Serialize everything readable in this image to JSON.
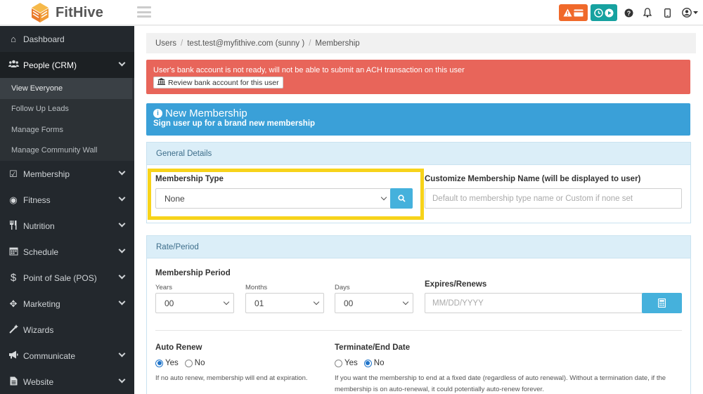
{
  "app": {
    "name": "FitHive"
  },
  "colors": {
    "alert_orange": "#f0692a",
    "teal": "#17a2a0",
    "danger": "#e8655a",
    "info": "#3aa0d8",
    "highlight": "#f7d31a",
    "sidebar_bg": "#23282d"
  },
  "sidebar": {
    "items": [
      {
        "label": "Dashboard",
        "icon": "home-icon"
      },
      {
        "label": "People (CRM)",
        "icon": "users-icon"
      },
      {
        "label": "Membership",
        "icon": "check-square-icon"
      },
      {
        "label": "Fitness",
        "icon": "person-circle-icon"
      },
      {
        "label": "Nutrition",
        "icon": "utensils-icon"
      },
      {
        "label": "Schedule",
        "icon": "calendar-icon"
      },
      {
        "label": "Point of Sale (POS)",
        "icon": "dollar-icon"
      },
      {
        "label": "Marketing",
        "icon": "crosshairs-icon"
      },
      {
        "label": "Wizards",
        "icon": "magic-wand-icon"
      },
      {
        "label": "Communicate",
        "icon": "megaphone-icon"
      },
      {
        "label": "Website",
        "icon": "file-icon"
      }
    ],
    "people_sub": [
      "View Everyone",
      "Follow Up Leads",
      "Manage Forms",
      "Manage Community Wall"
    ]
  },
  "breadcrumb": {
    "users": "Users",
    "account": "test.test@myfithive.com (sunny )",
    "current": "Membership"
  },
  "alert_bank": {
    "message": "User's bank account is not ready, will not be able to submit an ACH transaction on this user",
    "button": "Review bank account for this user"
  },
  "new_membership": {
    "title": "New Membership",
    "subtitle": "Sign user up for a brand new membership"
  },
  "general": {
    "heading": "General Details",
    "type_label": "Membership Type",
    "type_value": "None",
    "custom_name_label": "Customize Membership Name (will be displayed to user)",
    "custom_name_placeholder": "Default to membership type name or Custom if none set"
  },
  "rate": {
    "heading": "Rate/Period",
    "period_label": "Membership Period",
    "years_label": "Years",
    "years_value": "00",
    "months_label": "Months",
    "months_value": "01",
    "days_label": "Days",
    "days_value": "00",
    "expires_label": "Expires/Renews",
    "expires_placeholder": "MM/DD/YYYY",
    "auto_renew_label": "Auto Renew",
    "yes": "Yes",
    "no": "No",
    "auto_renew_help": "If no auto renew, membership will end at expiration.",
    "terminate_label": "Terminate/End Date",
    "terminate_help": "If you want the membership to end at a fixed date (regardless of auto renewal). Without a termination date, if the membership is on auto-renewal, it could potentially auto-renew forever."
  }
}
